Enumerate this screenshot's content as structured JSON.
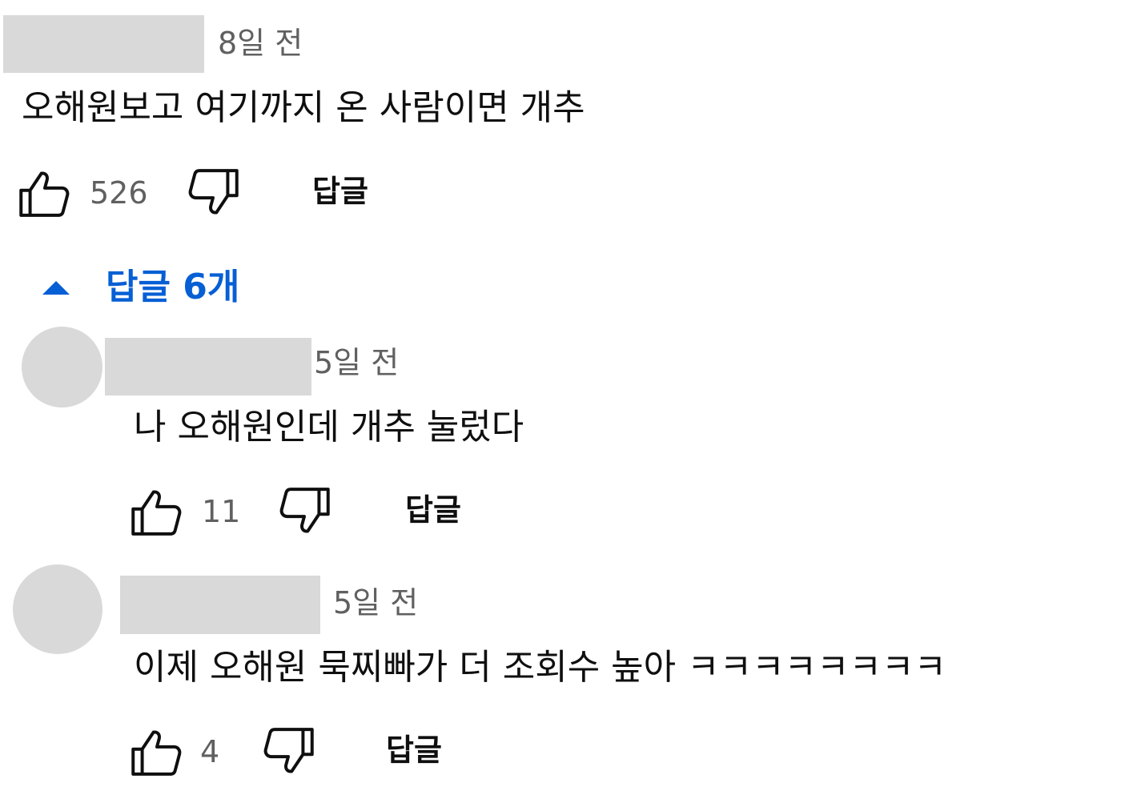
{
  "comments": [
    {
      "time": "8일 전",
      "text": "오해원보고 여기까지 온 사람이면 개추",
      "likes": "526",
      "reply_label": "답글"
    }
  ],
  "replies_toggle": {
    "label": "답글 6개"
  },
  "replies": [
    {
      "time": "5일 전",
      "text": "나 오해원인데 개추 눌렀다",
      "likes": "11",
      "reply_label": "답글"
    },
    {
      "time": "5일 전",
      "text": "이제 오해원 묵찌빠가 더 조회수 높아 ㅋㅋㅋㅋㅋㅋㅋㅋ",
      "likes": "4",
      "reply_label": "답글"
    }
  ],
  "icons": {
    "like": "thumbs-up-icon",
    "dislike": "thumbs-down-icon",
    "toggle": "caret-up-icon"
  },
  "colors": {
    "accent": "#065fd4",
    "secondary_text": "#606060",
    "redaction": "#d9d9d9"
  }
}
